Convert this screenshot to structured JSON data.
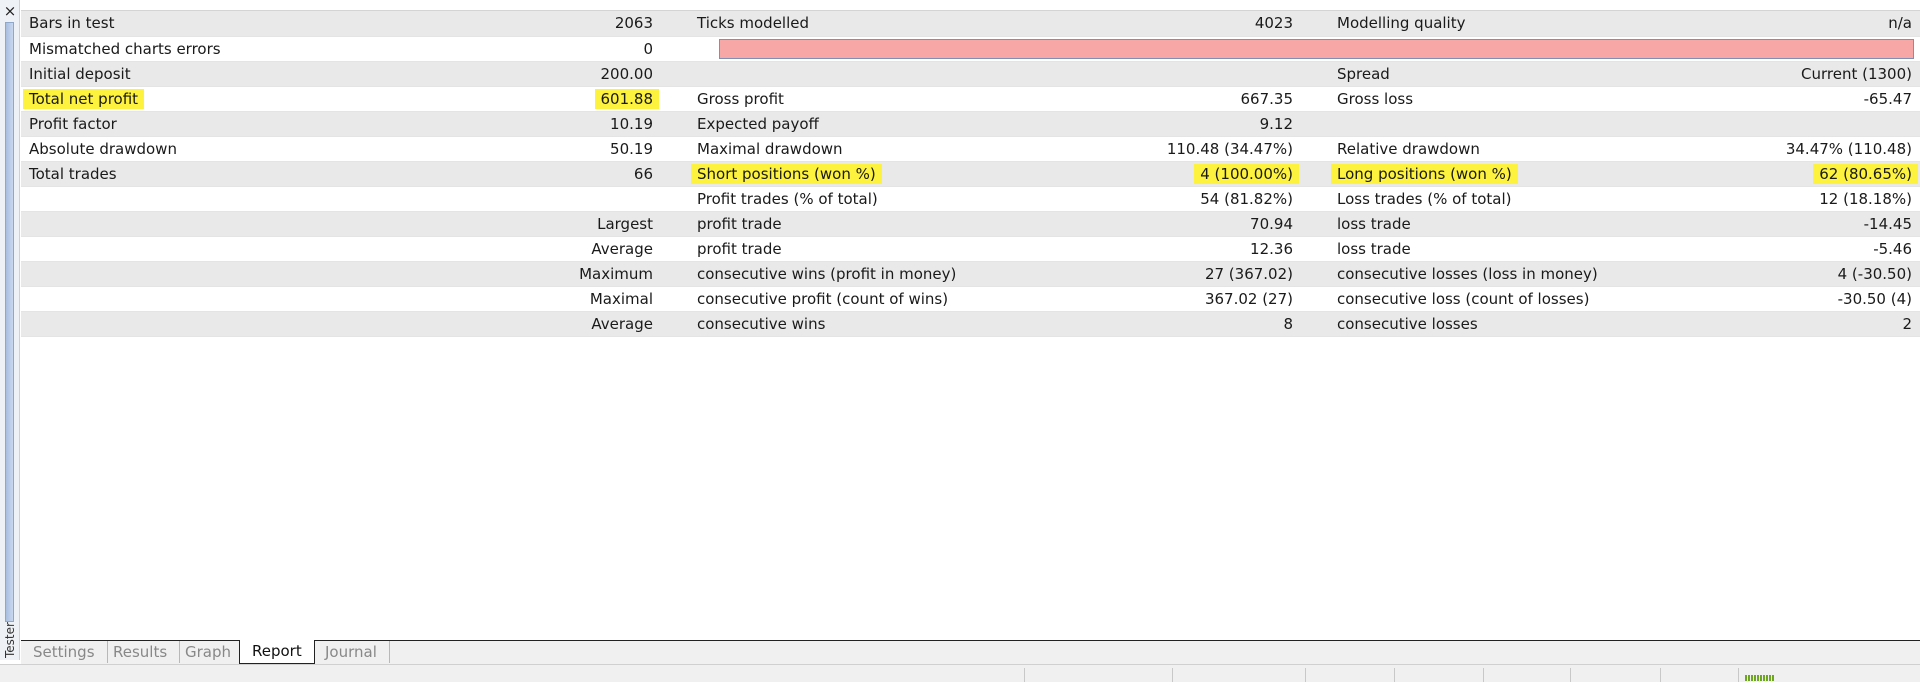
{
  "sidebar": {
    "close_glyph": "×",
    "label": "Tester"
  },
  "report": {
    "rows": [
      {
        "c1": "Bars in test",
        "c2": "2063",
        "c3": "Ticks modelled",
        "c4": "4023",
        "c5": "Modelling quality",
        "c6": "n/a"
      },
      {
        "c1": "Mismatched charts errors",
        "c2": "0"
      },
      {
        "c1": "Initial deposit",
        "c2": "200.00",
        "c3": "",
        "c4": "",
        "c5": "Spread",
        "c6": "Current (1300)"
      },
      {
        "c1": "Total net profit",
        "c2": "601.88",
        "c3": "Gross profit",
        "c4": "667.35",
        "c5": "Gross loss",
        "c6": "-65.47"
      },
      {
        "c1": "Profit factor",
        "c2": "10.19",
        "c3": "Expected payoff",
        "c4": "9.12",
        "c5": "",
        "c6": ""
      },
      {
        "c1": "Absolute drawdown",
        "c2": "50.19",
        "c3": "Maximal drawdown",
        "c4": "110.48 (34.47%)",
        "c5": "Relative drawdown",
        "c6": "34.47% (110.48)"
      },
      {
        "c1": "Total trades",
        "c2": "66",
        "c3": "Short positions (won %)",
        "c4": "4 (100.00%)",
        "c5": "Long positions (won %)",
        "c6": "62 (80.65%)"
      },
      {
        "c1": "",
        "c2": "",
        "c3": "Profit trades (% of total)",
        "c4": "54 (81.82%)",
        "c5": "Loss trades (% of total)",
        "c6": "12 (18.18%)"
      },
      {
        "c1": "",
        "c2": "Largest",
        "c3": "profit trade",
        "c4": "70.94",
        "c5": "loss trade",
        "c6": "-14.45"
      },
      {
        "c1": "",
        "c2": "Average",
        "c3": "profit trade",
        "c4": "12.36",
        "c5": "loss trade",
        "c6": "-5.46"
      },
      {
        "c1": "",
        "c2": "Maximum",
        "c3": "consecutive wins (profit in money)",
        "c4": "27 (367.02)",
        "c5": "consecutive losses (loss in money)",
        "c6": "4 (-30.50)"
      },
      {
        "c1": "",
        "c2": "Maximal",
        "c3": "consecutive profit (count of wins)",
        "c4": "367.02 (27)",
        "c5": "consecutive loss (count of losses)",
        "c6": "-30.50 (4)"
      },
      {
        "c1": "",
        "c2": "Average",
        "c3": "consecutive wins",
        "c4": "8",
        "c5": "consecutive losses",
        "c6": "2"
      }
    ],
    "colors": {
      "highlight": "#fdf23d",
      "mismatch_bar": "#f8a7a7",
      "row_shade": "#e9e9e9"
    }
  },
  "tabs": [
    {
      "label": "Settings"
    },
    {
      "label": "Results"
    },
    {
      "label": "Graph"
    },
    {
      "label": "Report"
    },
    {
      "label": "Journal"
    }
  ],
  "active_tab": "Report"
}
